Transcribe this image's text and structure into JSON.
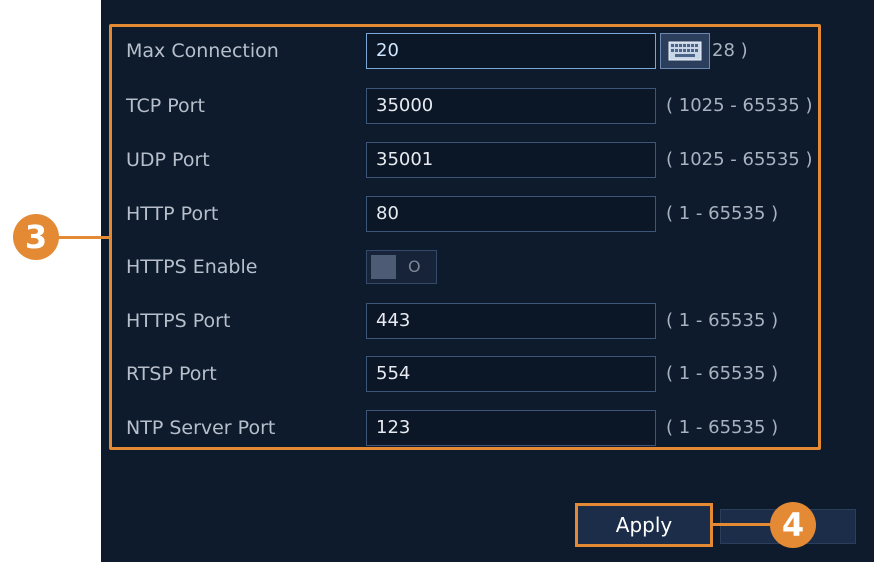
{
  "settings": {
    "rows": [
      {
        "label": "Max Connection",
        "value": "20",
        "range": "28 )"
      },
      {
        "label": "TCP Port",
        "value": "35000",
        "range": "( 1025 - 65535 )"
      },
      {
        "label": "UDP Port",
        "value": "35001",
        "range": "( 1025 - 65535 )"
      },
      {
        "label": "HTTP Port",
        "value": "80",
        "range": "( 1 - 65535 )"
      },
      {
        "label": "HTTPS Enable",
        "toggle_state": "off",
        "toggle_text": "O"
      },
      {
        "label": "HTTPS Port",
        "value": "443",
        "range": "( 1 - 65535 )"
      },
      {
        "label": "RTSP Port",
        "value": "554",
        "range": "( 1 - 65535 )"
      },
      {
        "label": "NTP Server Port",
        "value": "123",
        "range": "( 1 - 65535 )"
      }
    ],
    "keyboard_icon": "keyboard-icon"
  },
  "footer": {
    "apply_label": "Apply"
  },
  "callouts": {
    "step3": "3",
    "step4": "4"
  },
  "colors": {
    "accent": "#e48a34",
    "panel_background": "#0e1b2d"
  }
}
